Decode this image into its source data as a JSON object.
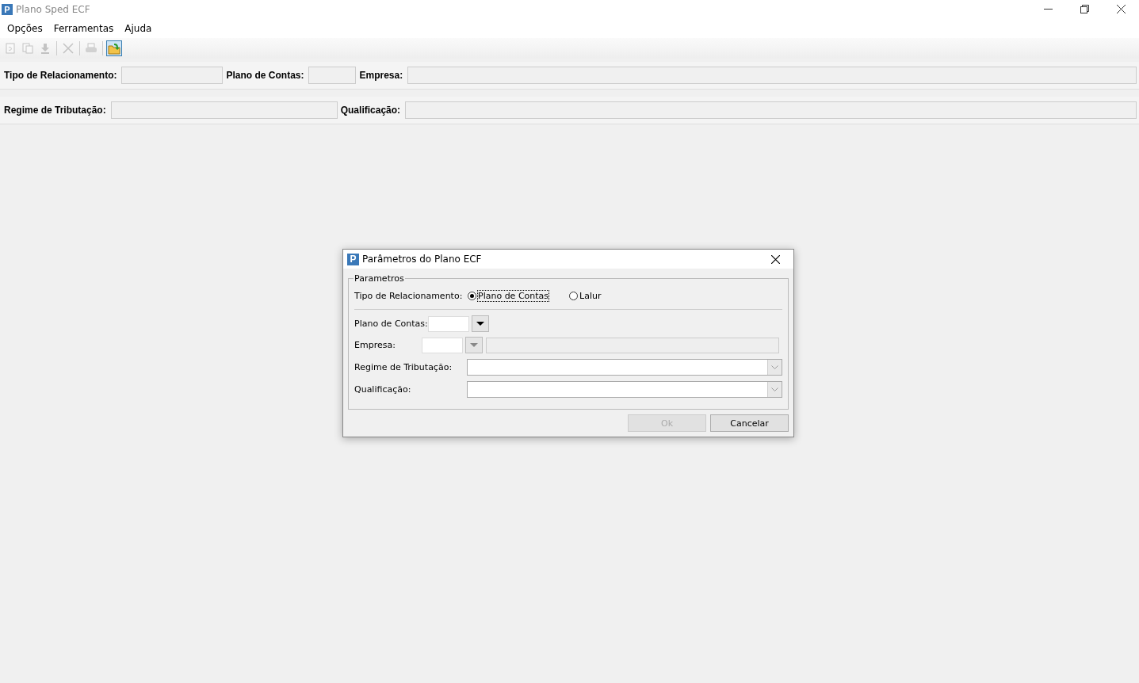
{
  "window": {
    "app_icon_letter": "P",
    "title": "Plano Sped ECF"
  },
  "menu": [
    "Opções",
    "Ferramentas",
    "Ajuda"
  ],
  "toolbar": [
    {
      "kind": "refresh",
      "disabled": true,
      "highlighted": false
    },
    {
      "kind": "copy",
      "disabled": true,
      "highlighted": false
    },
    {
      "kind": "import",
      "disabled": true,
      "highlighted": false
    },
    {
      "kind": "separator"
    },
    {
      "kind": "delete",
      "disabled": true,
      "highlighted": false
    },
    {
      "kind": "separator"
    },
    {
      "kind": "print",
      "disabled": true,
      "highlighted": false
    },
    {
      "kind": "separator"
    },
    {
      "kind": "open",
      "disabled": false,
      "highlighted": true
    }
  ],
  "header_rows": [
    [
      {
        "label": "Tipo de Relacionamento:"
      },
      {
        "label": "Plano de Contas:"
      },
      {
        "label": "Empresa:"
      }
    ],
    [
      {
        "label": "Regime de Tributação:"
      },
      {
        "label": "Qualificação:"
      }
    ]
  ],
  "dialog": {
    "app_icon_letter": "P",
    "title": "Parâmetros do Plano ECF",
    "group_title": "Parametros",
    "relation_label": "Tipo de Relacionamento:",
    "radios": [
      {
        "label": "Plano de Contas",
        "selected": true
      },
      {
        "label": "Lalur",
        "selected": false
      }
    ],
    "plano_label": "Plano de Contas:",
    "plano_arrow_disabled": false,
    "empresa_label": "Empresa:",
    "empresa_arrow_disabled": true,
    "regime_label": "Regime de Tributação:",
    "qualificacao_label": "Qualificação:",
    "buttons": [
      {
        "label": "Ok",
        "disabled": true
      },
      {
        "label": "Cancelar",
        "disabled": false
      }
    ]
  }
}
